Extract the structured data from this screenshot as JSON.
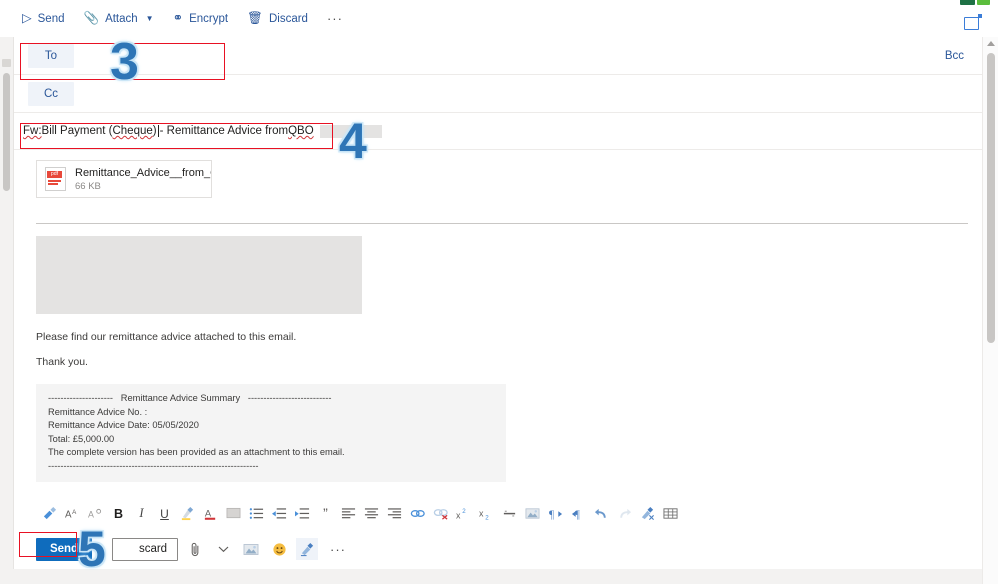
{
  "window": {
    "toolbar": {
      "send": "Send",
      "attach": "Attach",
      "encrypt": "Encrypt",
      "discard": "Discard",
      "overflow": "···",
      "popout_icon": "pop-out-icon"
    }
  },
  "compose": {
    "to_label": "To",
    "to_value": "",
    "cc_label": "Cc",
    "cc_value": "",
    "bcc_label": "Bcc",
    "subject": {
      "part_fw": "Fw:",
      "part_mid": " Bill Payment (",
      "part_cheque": "Cheque",
      "part_close": ")",
      "part_rest": " - Remittance Advice from ",
      "part_qbo": "QBO"
    },
    "attachment": {
      "name": "Remittance_Advice__from_QB...",
      "size": "66 KB",
      "icon": "pdf-file-icon"
    },
    "body": {
      "line1": "Please find our remittance advice attached to this email.",
      "line2": "Thank you.",
      "summary": {
        "header": "---------------------   Remittance Advice Summary   ---------------------------",
        "number": "Remittance Advice No. :",
        "date": "Remittance Advice Date: 05/05/2020",
        "total": "Total: £5,000.00",
        "note": "The complete version has been provided as an attachment to this email.",
        "footer": "--------------------------------------------------------------------"
      }
    }
  },
  "format_toolbar": {
    "items": [
      {
        "name": "format-painter-icon",
        "glyph": "✎"
      },
      {
        "name": "increase-font-size-icon",
        "glyph": "A"
      },
      {
        "name": "decrease-font-size-icon",
        "glyph": "A"
      },
      {
        "name": "bold-icon",
        "glyph": "B"
      },
      {
        "name": "italic-icon",
        "glyph": "I"
      },
      {
        "name": "underline-icon",
        "glyph": "U"
      },
      {
        "name": "highlight-icon",
        "glyph": "✐"
      },
      {
        "name": "font-color-icon",
        "glyph": "A"
      },
      {
        "name": "paragraph-shading-icon",
        "glyph": "▤"
      },
      {
        "name": "bulleted-list-icon",
        "glyph": "≡"
      },
      {
        "name": "decrease-indent-icon",
        "glyph": "⇤"
      },
      {
        "name": "increase-indent-icon",
        "glyph": "⇥"
      },
      {
        "name": "quote-icon",
        "glyph": "”"
      },
      {
        "name": "align-left-icon",
        "glyph": "≡"
      },
      {
        "name": "align-center-icon",
        "glyph": "≡"
      },
      {
        "name": "align-right-icon",
        "glyph": "≡"
      },
      {
        "name": "insert-link-icon",
        "glyph": "⚭"
      },
      {
        "name": "remove-link-icon",
        "glyph": "⚭"
      },
      {
        "name": "superscript-icon",
        "glyph": "x²"
      },
      {
        "name": "subscript-icon",
        "glyph": "x₂"
      },
      {
        "name": "strikethrough-icon",
        "glyph": "—"
      },
      {
        "name": "insert-picture-icon",
        "glyph": "▣"
      },
      {
        "name": "left-to-right-icon",
        "glyph": "¶"
      },
      {
        "name": "right-to-left-icon",
        "glyph": "¶"
      },
      {
        "name": "undo-icon",
        "glyph": "↶"
      },
      {
        "name": "redo-icon",
        "glyph": "↷"
      },
      {
        "name": "clear-formatting-icon",
        "glyph": "✗"
      },
      {
        "name": "insert-table-icon",
        "glyph": "⊞"
      }
    ]
  },
  "send_bar": {
    "send": "Send",
    "discard": "scard",
    "attach_icon": "paperclip-icon",
    "chevron_icon": "chevron-down-icon",
    "picture_icon": "insert-picture-icon",
    "emoji_icon": "emoji-icon",
    "signature_icon": "signature-icon",
    "overflow": "···"
  },
  "annotations": {
    "callouts": [
      {
        "label": "3"
      },
      {
        "label": "4"
      },
      {
        "label": "5"
      }
    ]
  }
}
